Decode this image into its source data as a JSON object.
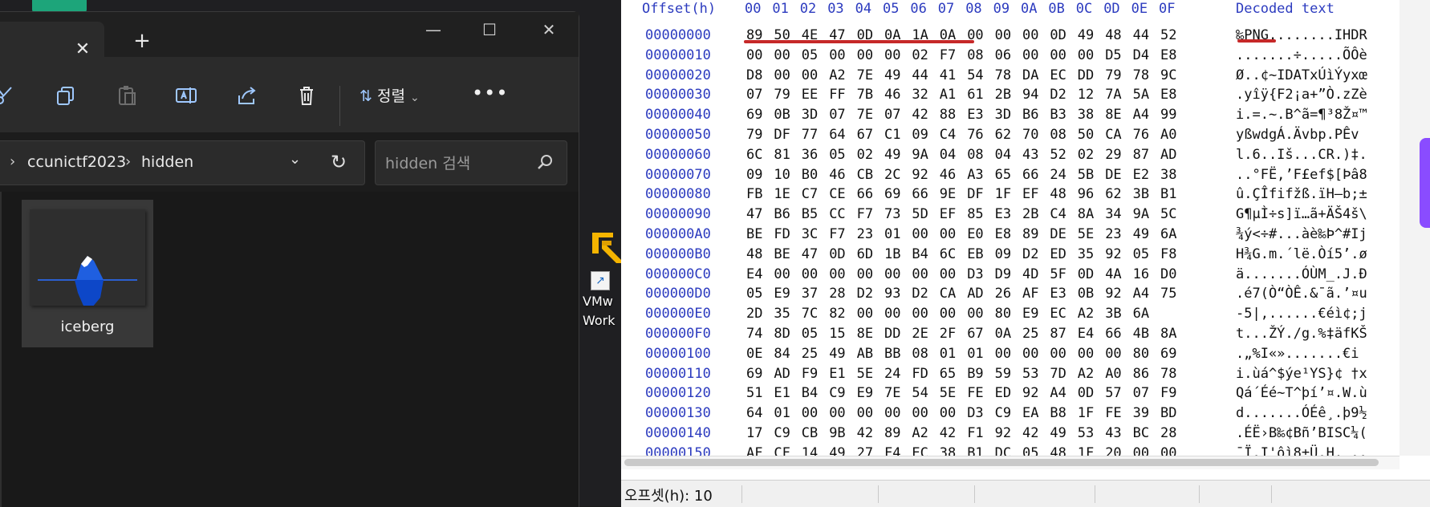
{
  "explorer": {
    "tab_close": "✕",
    "new_tab": "+",
    "toolbar": {
      "sort_label": "정렬",
      "more_label": "•••"
    },
    "address": {
      "crumbs": [
        "ccunictf2023",
        "hidden"
      ]
    },
    "search": {
      "placeholder": "hidden 검색"
    },
    "files": [
      {
        "name": "iceberg"
      }
    ]
  },
  "desktop": {
    "shortcut_label": "VMw\nWork"
  },
  "hex": {
    "header": {
      "offset_label": "Offset(h)",
      "columns": [
        "00",
        "01",
        "02",
        "03",
        "04",
        "05",
        "06",
        "07",
        "08",
        "09",
        "0A",
        "0B",
        "0C",
        "0D",
        "0E",
        "0F"
      ],
      "decoded_label": "Decoded text"
    },
    "rows": [
      {
        "offset": "00000000",
        "bytes": [
          "89",
          "50",
          "4E",
          "47",
          "0D",
          "0A",
          "1A",
          "0A",
          "00",
          "00",
          "00",
          "0D",
          "49",
          "48",
          "44",
          "52"
        ],
        "decoded": "‰PNG........IHDR"
      },
      {
        "offset": "00000010",
        "bytes": [
          "00",
          "00",
          "05",
          "00",
          "00",
          "00",
          "02",
          "F7",
          "08",
          "06",
          "00",
          "00",
          "00",
          "D5",
          "D4",
          "E8"
        ],
        "decoded": ".......÷.....ÕÔè"
      },
      {
        "offset": "00000020",
        "bytes": [
          "D8",
          "00",
          "00",
          "A2",
          "7E",
          "49",
          "44",
          "41",
          "54",
          "78",
          "DA",
          "EC",
          "DD",
          "79",
          "78",
          "9C"
        ],
        "decoded": "Ø..¢~IDATxÚìÝyxœ"
      },
      {
        "offset": "00000030",
        "bytes": [
          "07",
          "79",
          "EE",
          "FF",
          "7B",
          "46",
          "32",
          "A1",
          "61",
          "2B",
          "94",
          "D2",
          "12",
          "7A",
          "5A",
          "E8"
        ],
        "decoded": ".yîÿ{F2¡a+”Ò.zZè"
      },
      {
        "offset": "00000040",
        "bytes": [
          "69",
          "0B",
          "3D",
          "07",
          "7E",
          "07",
          "42",
          "88",
          "E3",
          "3D",
          "B6",
          "B3",
          "38",
          "8E",
          "A4",
          "99"
        ],
        "decoded": "i.=.~.B^ã=¶³8Ž¤™"
      },
      {
        "offset": "00000050",
        "bytes": [
          "79",
          "DF",
          "77",
          "64",
          "67",
          "C1",
          "09",
          "C4",
          "76",
          "62",
          "70",
          "08",
          "50",
          "CA",
          "76",
          "A0"
        ],
        "decoded": "yßwdgÁ.Ävbp.PÊv "
      },
      {
        "offset": "00000060",
        "bytes": [
          "6C",
          "81",
          "36",
          "05",
          "02",
          "49",
          "9A",
          "04",
          "08",
          "04",
          "43",
          "52",
          "02",
          "29",
          "87",
          "AD"
        ],
        "decoded": "l.6..Iš...CR.)‡."
      },
      {
        "offset": "00000070",
        "bytes": [
          "09",
          "10",
          "B0",
          "46",
          "CB",
          "2C",
          "92",
          "46",
          "A3",
          "65",
          "66",
          "24",
          "5B",
          "DE",
          "E2",
          "38"
        ],
        "decoded": "..°FË,’F£ef$[Þâ8"
      },
      {
        "offset": "00000080",
        "bytes": [
          "FB",
          "1E",
          "C7",
          "CE",
          "66",
          "69",
          "66",
          "9E",
          "DF",
          "1F",
          "EF",
          "48",
          "96",
          "62",
          "3B",
          "B1"
        ],
        "decoded": "û.ÇÎfifžß.ïH–b;±"
      },
      {
        "offset": "00000090",
        "bytes": [
          "47",
          "B6",
          "B5",
          "CC",
          "F7",
          "73",
          "5D",
          "EF",
          "85",
          "E3",
          "2B",
          "C4",
          "8A",
          "34",
          "9A",
          "5C"
        ],
        "decoded": "G¶µÌ÷s]ï…ã+ÄŠ4š\\"
      },
      {
        "offset": "000000A0",
        "bytes": [
          "BE",
          "FD",
          "3C",
          "F7",
          "23",
          "01",
          "00",
          "00",
          "E0",
          "E8",
          "89",
          "DE",
          "5E",
          "23",
          "49",
          "6A"
        ],
        "decoded": "¾ý<÷#...àè‰Þ^#Ij"
      },
      {
        "offset": "000000B0",
        "bytes": [
          "48",
          "BE",
          "47",
          "0D",
          "6D",
          "1B",
          "B4",
          "6C",
          "EB",
          "09",
          "D2",
          "ED",
          "35",
          "92",
          "05",
          "F8"
        ],
        "decoded": "H¾G.m.´lë.Òí5’.ø"
      },
      {
        "offset": "000000C0",
        "bytes": [
          "E4",
          "00",
          "00",
          "00",
          "00",
          "00",
          "00",
          "00",
          "D3",
          "D9",
          "4D",
          "5F",
          "0D",
          "4A",
          "16",
          "D0"
        ],
        "decoded": "ä.......ÓÙM_.J.Ð"
      },
      {
        "offset": "000000D0",
        "bytes": [
          "05",
          "E9",
          "37",
          "28",
          "D2",
          "93",
          "D2",
          "CA",
          "AD",
          "26",
          "AF",
          "E3",
          "0B",
          "92",
          "A4",
          "75"
        ],
        "decoded": ".é7(Ò“ÒÊ.&¯ã.’¤u"
      },
      {
        "offset": "000000E0",
        "bytes": [
          "2D",
          "35",
          "7C",
          "82",
          "00",
          "00",
          "00",
          "00",
          "00",
          "80",
          "E9",
          "EC",
          "A2",
          "3B",
          "6A"
        ],
        "decoded": "-5|‚......€éì¢;j"
      },
      {
        "offset": "000000F0",
        "bytes": [
          "74",
          "8D",
          "05",
          "15",
          "8E",
          "DD",
          "2E",
          "2F",
          "67",
          "0A",
          "25",
          "87",
          "E4",
          "66",
          "4B",
          "8A"
        ],
        "decoded": "t...ŽÝ./g.%‡äfKŠ"
      },
      {
        "offset": "00000100",
        "bytes": [
          "0E",
          "84",
          "25",
          "49",
          "AB",
          "BB",
          "08",
          "01",
          "01",
          "00",
          "00",
          "00",
          "00",
          "00",
          "80",
          "69"
        ],
        "decoded": ".„%I«».......€i"
      },
      {
        "offset": "00000110",
        "bytes": [
          "69",
          "AD",
          "F9",
          "E1",
          "5E",
          "24",
          "FD",
          "65",
          "B9",
          "59",
          "53",
          "7D",
          "A2",
          "A0",
          "86",
          "78"
        ],
        "decoded": "i.ùá^$ýe¹YS}¢ †x"
      },
      {
        "offset": "00000120",
        "bytes": [
          "51",
          "E1",
          "B4",
          "C9",
          "E9",
          "7E",
          "54",
          "5E",
          "FE",
          "ED",
          "92",
          "A4",
          "0D",
          "57",
          "07",
          "F9"
        ],
        "decoded": "Qá´Éé~T^þí’¤.W.ù"
      },
      {
        "offset": "00000130",
        "bytes": [
          "64",
          "01",
          "00",
          "00",
          "00",
          "00",
          "00",
          "00",
          "D3",
          "C9",
          "EA",
          "B8",
          "1F",
          "FE",
          "39",
          "BD"
        ],
        "decoded": "d.......ÓÉê¸.þ9½"
      },
      {
        "offset": "00000140",
        "bytes": [
          "17",
          "C9",
          "CB",
          "9B",
          "42",
          "89",
          "A2",
          "42",
          "F1",
          "92",
          "42",
          "49",
          "53",
          "43",
          "BC",
          "28"
        ],
        "decoded": ".ÉË›B‰¢Bñ’BISC¼("
      },
      {
        "offset": "00000150",
        "bytes": [
          "AF",
          "CF",
          "14",
          "49",
          "27",
          "F4",
          "EC",
          "38",
          "B1",
          "DC",
          "05",
          "48",
          "1F",
          "20",
          "00",
          "00"
        ],
        "decoded": "¯Ï.I'ôì8±Ü.H. .."
      }
    ],
    "status": "오프셋(h): 10"
  }
}
